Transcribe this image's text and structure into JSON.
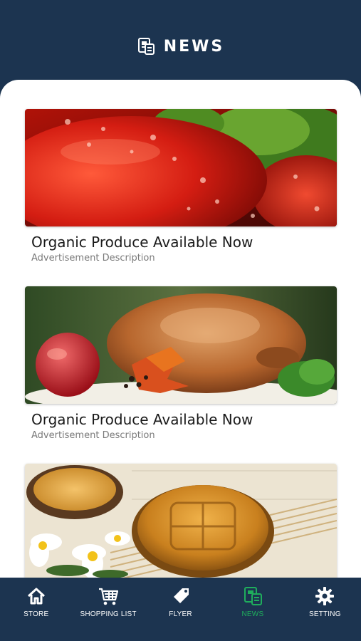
{
  "header": {
    "title": "NEWS",
    "icon": "news-icon"
  },
  "news": [
    {
      "title": "Organic Produce Available Now",
      "description": "Advertisement Description",
      "image": "tomatoes-photo"
    },
    {
      "title": "Organic Produce Available Now",
      "description": "Advertisement Description",
      "image": "roast-chicken-photo"
    },
    {
      "title": "",
      "description": "",
      "image": "mooncake-tea-photo"
    }
  ],
  "tabs": [
    {
      "label": "STORE",
      "icon": "home-icon"
    },
    {
      "label": "SHOPPING LIST",
      "icon": "cart-icon"
    },
    {
      "label": "FLYER",
      "icon": "tag-icon"
    },
    {
      "label": "NEWS",
      "icon": "news-icon",
      "active": true
    },
    {
      "label": "SETTING",
      "icon": "gear-icon"
    }
  ],
  "colors": {
    "navy": "#1c3450",
    "active": "#1fae5c",
    "white": "#ffffff"
  }
}
